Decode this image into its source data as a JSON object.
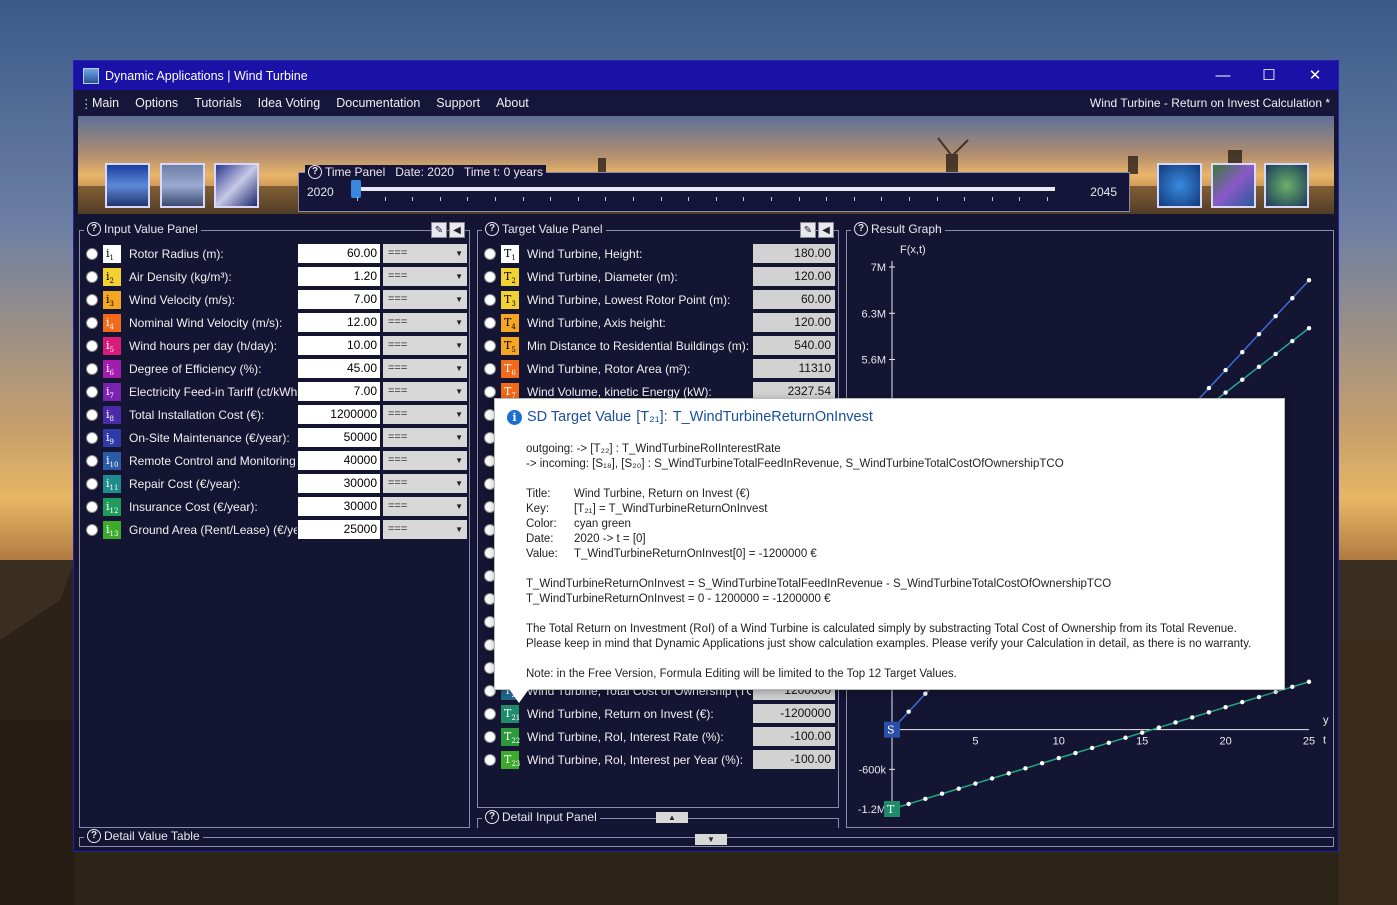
{
  "window": {
    "title": "Dynamic Applications | Wind Turbine",
    "minimize": "—",
    "maximize": "☐",
    "close": "✕"
  },
  "menu": {
    "items": [
      "Main",
      "Options",
      "Tutorials",
      "Idea Voting",
      "Documentation",
      "Support",
      "About"
    ],
    "document_title": "Wind Turbine - Return on Invest Calculation *"
  },
  "time_panel": {
    "label": "Time Panel",
    "date_label": "Date:",
    "date_value": "2020",
    "time_label": "Time t:",
    "time_value": "0",
    "time_unit": "years",
    "start": "2020",
    "end": "2045",
    "position": 0
  },
  "input_panel": {
    "title": "Input Value Panel",
    "operator": "===",
    "rows": [
      {
        "key": "i",
        "sub": "1",
        "label": "Rotor Radius (m):",
        "value": "60.00",
        "color": "#ffffff",
        "text_color": "#000000"
      },
      {
        "key": "i",
        "sub": "2",
        "label": "Air Density (kg/m³):",
        "value": "1.20",
        "color": "#f2d235",
        "text_color": "#000000"
      },
      {
        "key": "i",
        "sub": "3",
        "label": "Wind Velocity (m/s):",
        "value": "7.00",
        "color": "#f5a623",
        "text_color": "#000000"
      },
      {
        "key": "i",
        "sub": "4",
        "label": "Nominal Wind Velocity (m/s):",
        "value": "12.00",
        "color": "#f06a1a",
        "text_color": "#ffffff"
      },
      {
        "key": "i",
        "sub": "5",
        "label": "Wind hours per day (h/day):",
        "value": "10.00",
        "color": "#d81b7a",
        "text_color": "#ffffff"
      },
      {
        "key": "i",
        "sub": "6",
        "label": "Degree of Efficiency (%):",
        "value": "45.00",
        "color": "#a21caf",
        "text_color": "#ffffff"
      },
      {
        "key": "i",
        "sub": "7",
        "label": "Electricity Feed-in Tariff (ct/kWh):",
        "value": "7.00",
        "color": "#7b22b0",
        "text_color": "#ffffff"
      },
      {
        "key": "i",
        "sub": "8",
        "label": "Total Installation Cost (€):",
        "value": "1200000",
        "color": "#4b2aa8",
        "text_color": "#ffffff"
      },
      {
        "key": "i",
        "sub": "9",
        "label": "On-Site Maintenance (€/year):",
        "value": "50000",
        "color": "#2f3aa8",
        "text_color": "#ffffff"
      },
      {
        "key": "i",
        "sub": "10",
        "label": "Remote Control and Monitoring (€/y",
        "value": "40000",
        "color": "#2c5aa8",
        "text_color": "#ffffff"
      },
      {
        "key": "i",
        "sub": "11",
        "label": "Repair Cost (€/year):",
        "value": "30000",
        "color": "#1e8c8c",
        "text_color": "#ffffff"
      },
      {
        "key": "i",
        "sub": "12",
        "label": "Insurance Cost (€/year):",
        "value": "30000",
        "color": "#1e9a5a",
        "text_color": "#ffffff"
      },
      {
        "key": "i",
        "sub": "13",
        "label": "Ground Area (Rent/Lease) (€/year):",
        "value": "25000",
        "color": "#3caa2a",
        "text_color": "#ffffff"
      }
    ]
  },
  "target_panel": {
    "title": "Target Value Panel",
    "rows_top": [
      {
        "key": "T",
        "sub": "1",
        "label": "Wind Turbine, Height:",
        "value": "180.00",
        "color": "#ffffff",
        "text_color": "#000000"
      },
      {
        "key": "T",
        "sub": "2",
        "label": "Wind Turbine, Diameter (m):",
        "value": "120.00",
        "color": "#f2d235",
        "text_color": "#000000"
      },
      {
        "key": "T",
        "sub": "3",
        "label": "Wind Turbine, Lowest Rotor Point (m):",
        "value": "60.00",
        "color": "#f2d235",
        "text_color": "#000000"
      },
      {
        "key": "T",
        "sub": "4",
        "label": "Wind Turbine, Axis height:",
        "value": "120.00",
        "color": "#f5a623",
        "text_color": "#000000"
      },
      {
        "key": "T",
        "sub": "5",
        "label": "Min Distance to Residential Buildings (m):",
        "value": "540.00",
        "color": "#f5a623",
        "text_color": "#000000"
      },
      {
        "key": "T",
        "sub": "6",
        "label": "Wind Turbine, Rotor Area (m²):",
        "value": "11310",
        "color": "#f06a1a",
        "text_color": "#ffffff"
      },
      {
        "key": "T",
        "sub": "7",
        "label": "Wind Volume, kinetic Energy (kW):",
        "value": "2327.54",
        "color": "#f06a1a",
        "text_color": "#ffffff"
      }
    ],
    "rows_bottom": [
      {
        "key": "T",
        "sub": "20",
        "label": "Wind Turbine, Total Cost of Ownership (TCO) (€):",
        "value": "1200000",
        "color": "#1e6a8c",
        "text_color": "#ffffff"
      },
      {
        "key": "T",
        "sub": "21",
        "label": "Wind Turbine, Return on Invest (€):",
        "value": "-1200000",
        "color": "#1e8c6a",
        "text_color": "#ffffff"
      },
      {
        "key": "T",
        "sub": "22",
        "label": "Wind Turbine, RoI, Interest Rate (%):",
        "value": "-100.00",
        "color": "#2a9a3a",
        "text_color": "#ffffff"
      },
      {
        "key": "T",
        "sub": "23",
        "label": "Wind Turbine, RoI, Interest per Year (%):",
        "value": "-100.00",
        "color": "#3caa2a",
        "text_color": "#ffffff"
      }
    ]
  },
  "detail_input_panel": {
    "title": "Detail Input Panel"
  },
  "detail_value_table": {
    "title": "Detail Value Table"
  },
  "result_graph": {
    "title": "Result Graph",
    "y_axis_label": "F(x,t)",
    "x_axis_label": "t",
    "y_mark": "y",
    "s_marker": {
      "key": "S",
      "sub": "2"
    },
    "t_marker": {
      "key": "T",
      "sub": "21"
    }
  },
  "tooltip": {
    "title_prefix": "SD Target Value",
    "title_key": "[T₂₁]:",
    "title_name": "T_WindTurbineReturnOnInvest",
    "outgoing": "outgoing:  ->  [T₂₂] :  T_WindTurbineRoIInterestRate",
    "incoming": "-> incoming:   [S₁₈], [S₂₀] :  S_WindTurbineTotalFeedInRevenue,  S_WindTurbineTotalCostOfOwnershipTCO",
    "fields": [
      {
        "k": "Title:",
        "v": "Wind Turbine, Return on Invest (€)"
      },
      {
        "k": "Key:",
        "v": "[T₂₁] = T_WindTurbineReturnOnInvest"
      },
      {
        "k": "Color:",
        "v": "cyan green"
      },
      {
        "k": "Date:",
        "v": "2020  ->  t = [0]"
      },
      {
        "k": "Value:",
        "v": "T_WindTurbineReturnOnInvest[0] = -1200000 €"
      }
    ],
    "formula1": "T_WindTurbineReturnOnInvest  =  S_WindTurbineTotalFeedInRevenue - S_WindTurbineTotalCostOfOwnershipTCO",
    "formula2": "T_WindTurbineReturnOnInvest  =  0 - 1200000  =  -1200000  €",
    "desc1": "The Total Return on Investment (RoI) of a Wind Turbine is calculated simply by substracting Total Cost of Ownership from its Total Revenue.",
    "desc2": "Please keep in mind that Dynamic Applications just show calculation examples. Please verify your Calculation in detail, as there is no warranty.",
    "note": "Note: in the Free Version, Formula Editing will be limited to the Top 12 Target Values."
  },
  "chart_data": {
    "type": "line",
    "y_ticks": [
      "7M",
      "6.3M",
      "5.6M",
      "-600k",
      "-1.2M"
    ],
    "x_ticks": [
      "5",
      "10",
      "15",
      "20",
      "25"
    ],
    "xlim": [
      0,
      25
    ],
    "ylim": [
      -1200000,
      7000000
    ],
    "series": [
      {
        "x": [
          0,
          1,
          2,
          3,
          4,
          5,
          6,
          7,
          8,
          9,
          10,
          11,
          12,
          13,
          14,
          15,
          16,
          17,
          18,
          19,
          20,
          21,
          22,
          23,
          24,
          25
        ],
        "values": [
          0,
          272000,
          544000,
          816000,
          1088000,
          1360000,
          1632000,
          1904000,
          2176000,
          2448000,
          2720000,
          2992000,
          3264000,
          3536000,
          3808000,
          4080000,
          4352000,
          4624000,
          4896000,
          5168000,
          5440000,
          5712000,
          5984000,
          6256000,
          6528000,
          6800000
        ],
        "color": "#3b6fd6"
      },
      {
        "x": [
          0,
          1,
          2,
          3,
          4,
          5,
          6,
          7,
          8,
          9,
          10,
          11,
          12,
          13,
          14,
          15,
          16,
          17,
          18,
          19,
          20,
          21,
          22,
          23,
          24,
          25
        ],
        "values": [
          1200000,
          1395000,
          1590000,
          1785000,
          1980000,
          2175000,
          2370000,
          2565000,
          2760000,
          2955000,
          3150000,
          3345000,
          3540000,
          3735000,
          3930000,
          4125000,
          4320000,
          4515000,
          4710000,
          4905000,
          5100000,
          5295000,
          5490000,
          5685000,
          5880000,
          6075000
        ],
        "color": "#22a8a0"
      },
      {
        "x": [
          0,
          1,
          2,
          3,
          4,
          5,
          6,
          7,
          8,
          9,
          10,
          11,
          12,
          13,
          14,
          15,
          16,
          17,
          18,
          19,
          20,
          21,
          22,
          23,
          24,
          25
        ],
        "values": [
          -1200000,
          -1123000,
          -1046000,
          -969000,
          -892000,
          -815000,
          -738000,
          -661000,
          -584000,
          -507000,
          -430000,
          -353000,
          -276000,
          -199000,
          -122000,
          -45000,
          32000,
          109000,
          186000,
          263000,
          340000,
          417000,
          494000,
          571000,
          648000,
          725000
        ],
        "color": "#22a880"
      }
    ]
  }
}
